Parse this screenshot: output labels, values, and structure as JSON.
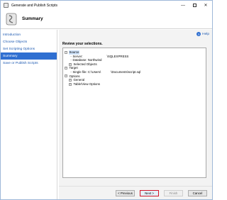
{
  "window": {
    "title": "Generate and Publish Scripts",
    "controls": {
      "minimize": "—",
      "close": "✕"
    }
  },
  "header": {
    "title": "Summary"
  },
  "sidebar": {
    "items": [
      {
        "label": "Introduction"
      },
      {
        "label": "Choose Objects"
      },
      {
        "label": "Set Scripting Options"
      },
      {
        "label": "Summary"
      },
      {
        "label": "Save or Publish Scripts"
      }
    ],
    "active_index": 3
  },
  "content": {
    "help_label": "Help",
    "review_label": "Review your selections.",
    "tree": {
      "source": {
        "label": "Source",
        "toggle": "−"
      },
      "server": {
        "key": "Server:",
        "value": "\\SQLEXPRESS"
      },
      "database": {
        "text": "Database: Northwind"
      },
      "selected_objects": {
        "label": "Selected Objects",
        "toggle": "+"
      },
      "target": {
        "label": "Target",
        "toggle": "−"
      },
      "single_file": {
        "key": "Single file: C:\\Users\\",
        "value": "\\Documents\\script.sql"
      },
      "options": {
        "label": "Options",
        "toggle": "−"
      },
      "general": {
        "label": "General",
        "toggle": "+"
      },
      "table_view": {
        "label": "Table/View Options",
        "toggle": "+"
      }
    }
  },
  "footer": {
    "previous": "< Previous",
    "next": "Next >",
    "finish": "Finish",
    "cancel": "Cancel"
  }
}
